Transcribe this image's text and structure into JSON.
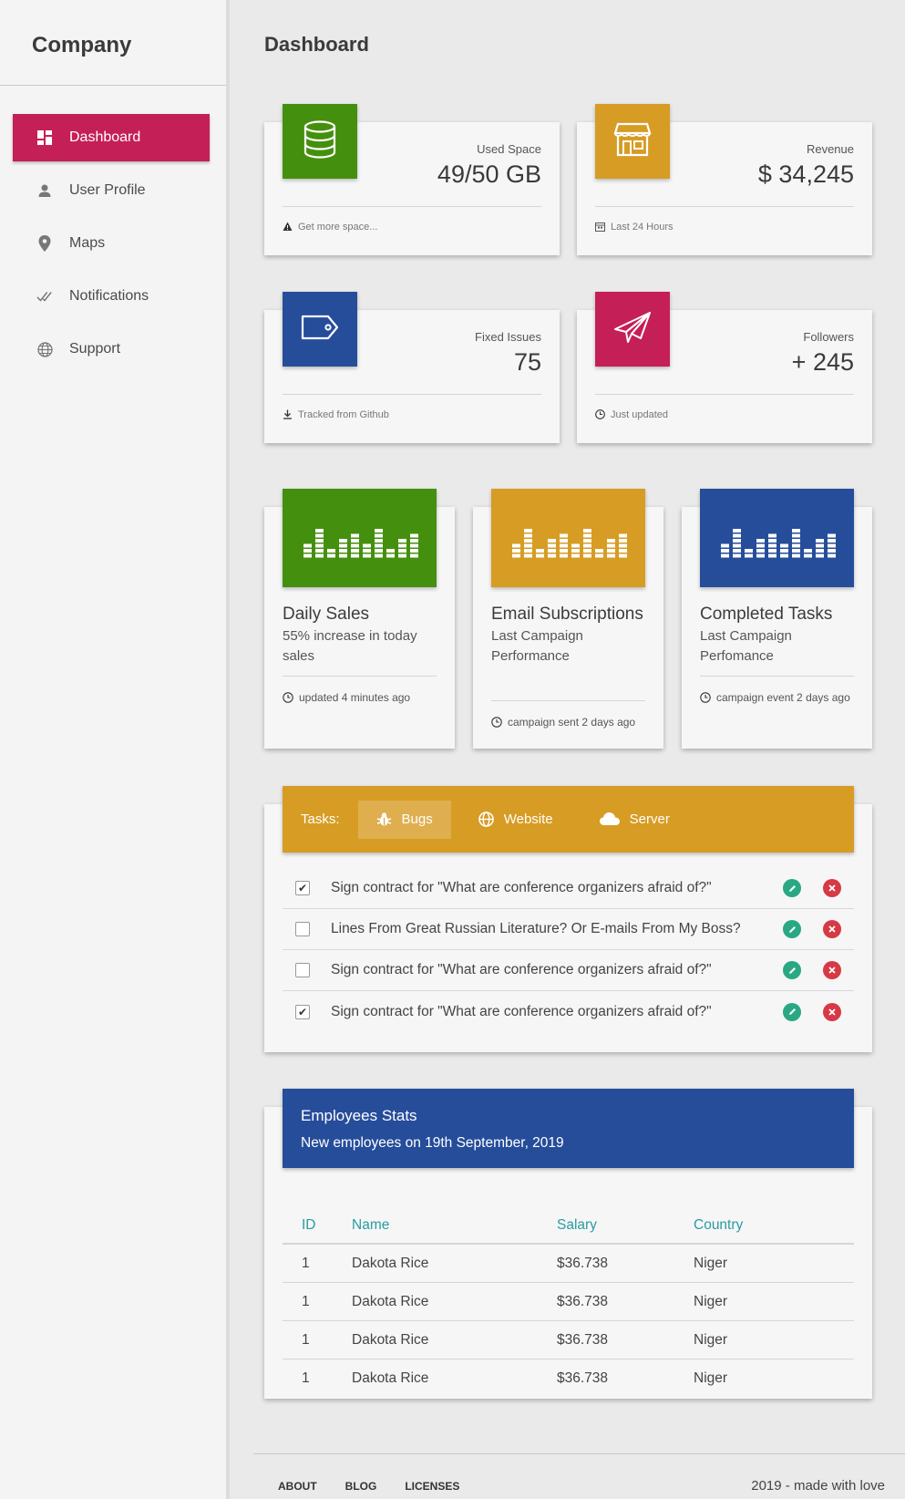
{
  "brand": "Company",
  "sidebar": {
    "items": [
      {
        "label": "Dashboard",
        "icon": "dashboard-icon",
        "active": true
      },
      {
        "label": "User Profile",
        "icon": "person-icon"
      },
      {
        "label": "Maps",
        "icon": "location-pin-icon"
      },
      {
        "label": "Notifications",
        "icon": "double-check-icon"
      },
      {
        "label": "Support",
        "icon": "globe-icon"
      }
    ]
  },
  "page": {
    "title": "Dashboard"
  },
  "stats": [
    {
      "category": "Used Space",
      "value": "49/50 GB",
      "footer": "Get more space...",
      "footer_icon": "warning-icon",
      "tile_icon": "database-icon",
      "color": "#44900e"
    },
    {
      "category": "Revenue",
      "value": "$ 34,245",
      "footer": "Last 24 Hours",
      "footer_icon": "calendar-icon",
      "tile_icon": "store-icon",
      "color": "#d79c24"
    },
    {
      "category": "Fixed Issues",
      "value": "75",
      "footer": "Tracked from Github",
      "footer_icon": "download-icon",
      "tile_icon": "tag-icon",
      "color": "#264d9a"
    },
    {
      "category": "Followers",
      "value": "+ 245",
      "footer": "Just updated",
      "footer_icon": "clock-icon",
      "tile_icon": "paper-plane-icon",
      "color": "#c51f57"
    }
  ],
  "charts": [
    {
      "title": "Daily Sales",
      "subtitle": "55% increase in today sales",
      "footer": "updated 4 minutes ago",
      "color": "#44900e"
    },
    {
      "title": "Email Subscriptions",
      "subtitle": "Last Campaign Performance",
      "footer": "campaign sent 2 days ago",
      "color": "#d79c24"
    },
    {
      "title": "Completed Tasks",
      "subtitle": "Last Campaign Perfomance",
      "footer": "campaign event 2 days ago",
      "color": "#264d9a"
    }
  ],
  "tasks": {
    "label": "Tasks:",
    "tabs": [
      {
        "label": "Bugs",
        "icon": "bug-icon",
        "active": true
      },
      {
        "label": "Website",
        "icon": "globe-icon"
      },
      {
        "label": "Server",
        "icon": "cloud-icon"
      }
    ],
    "items": [
      {
        "text": "Sign contract for \"What are conference organizers afraid of?\"",
        "checked": true
      },
      {
        "text": "Lines From Great Russian Literature? Or E-mails From My Boss?",
        "checked": false
      },
      {
        "text": "Sign contract for \"What are conference organizers afraid of?\"",
        "checked": false
      },
      {
        "text": "Sign contract for \"What are conference organizers afraid of?\"",
        "checked": true
      }
    ]
  },
  "employees": {
    "title": "Employees Stats",
    "subtitle": "New employees on 19th September, 2019",
    "headers": [
      "ID",
      "Name",
      "Salary",
      "Country"
    ],
    "rows": [
      [
        "1",
        "Dakota Rice",
        "$36.738",
        "Niger"
      ],
      [
        "1",
        "Dakota Rice",
        "$36.738",
        "Niger"
      ],
      [
        "1",
        "Dakota Rice",
        "$36.738",
        "Niger"
      ],
      [
        "1",
        "Dakota Rice",
        "$36.738",
        "Niger"
      ]
    ]
  },
  "footer": {
    "links": [
      "ABOUT",
      "BLOG",
      "LICENSES"
    ],
    "copyright": "2019 - made with love"
  }
}
